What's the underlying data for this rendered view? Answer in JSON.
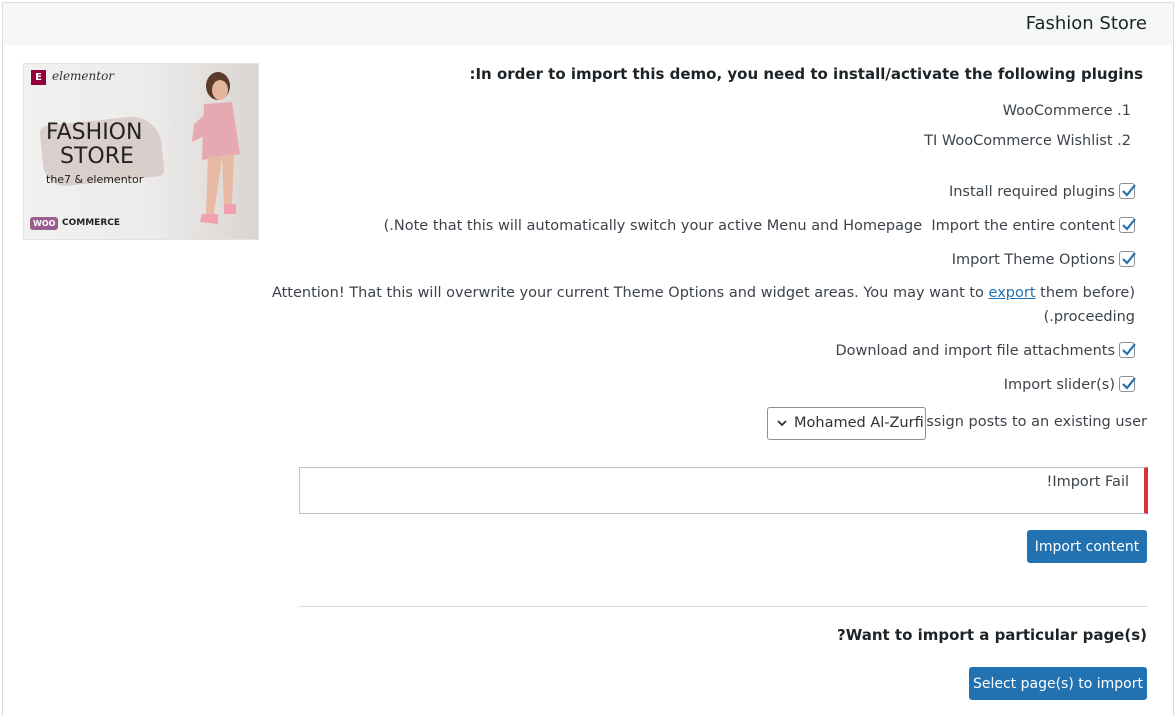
{
  "window": {
    "title": "Fashion Store"
  },
  "thumbnail": {
    "brand": "elementor",
    "line1": "FASHION",
    "line2": "STORE",
    "line3": "the7 & elementor",
    "woo_badge": "WOO",
    "woo_text": "COMMERCE"
  },
  "plugins": {
    "heading": ":In order to import this demo, you need to install/activate the following plugins",
    "items": [
      "WooCommerce .1",
      "TI WooCommerce Wishlist .2"
    ]
  },
  "options": {
    "install_plugins": {
      "label": "Install required plugins",
      "checked": true
    },
    "entire_content": {
      "note": "(.Note that this will automatically switch your active Menu and Homepage",
      "label": "Import the entire content",
      "checked": true
    },
    "theme_options": {
      "label": "Import Theme Options",
      "checked": true
    },
    "attention": {
      "before_link": "Attention! That this will overwrite your current Theme Options and widget areas. You may want to",
      "link": "export",
      "after_link": "them before)",
      "line2": "(.proceeding"
    },
    "attachments": {
      "label": "Download and import file attachments",
      "checked": true
    },
    "sliders": {
      "label": "Import slider(s)",
      "checked": true
    }
  },
  "assign_user": {
    "label": ":Assign posts to an existing user",
    "selected": "Mohamed Al-Zurfi"
  },
  "notice": {
    "text": "!Import Fail"
  },
  "import_button": {
    "label": "Import content"
  },
  "pages": {
    "heading": "?Want to import a particular page(s)",
    "button": "Select page(s) to import"
  },
  "colors": {
    "accent": "#2271b1",
    "error": "#d63638",
    "check": "#2271b1"
  }
}
